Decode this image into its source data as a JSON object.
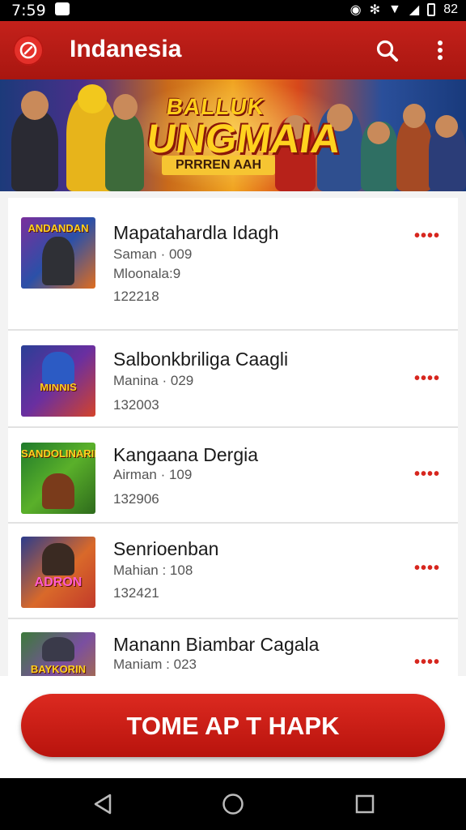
{
  "status_bar": {
    "time": "7:59",
    "right_text": "82"
  },
  "app_bar": {
    "title": "Indanesia",
    "icons": [
      "app-logo-icon",
      "search-icon",
      "more-vert-icon"
    ]
  },
  "banner": {
    "line1": "BALLUK",
    "line2": "UNGMAIA",
    "line3": "PRRREN AAH"
  },
  "list": [
    {
      "title": "Mapatahardla Idagh",
      "line1": "Saman · 009",
      "line2": "Mloonala:9",
      "line3": "122218",
      "thumb_label": "ANDANDAN"
    },
    {
      "title": "Salbonkbriliga Caagli",
      "line1": "Manina · 029",
      "line2": "",
      "line3": "132003",
      "thumb_label": "MINNIS"
    },
    {
      "title": "Kangaana Dergia",
      "line1": "Airman · 109",
      "line2": "",
      "line3": "132906",
      "thumb_label": "SANDOLINARIN"
    },
    {
      "title": "Senrioenban",
      "line1": "Mahian : 108",
      "line2": "",
      "line3": "132421",
      "thumb_label": "ADRON"
    },
    {
      "title": "Manann Biambar Cagala",
      "line1": "Maniam : 023",
      "line2": "",
      "line3": "",
      "thumb_label": "BAYKORIN"
    }
  ],
  "cta": {
    "label": "TOME AP T HAPK"
  },
  "colors": {
    "brand_red": "#c4211b",
    "accent_red": "#d7261e"
  }
}
